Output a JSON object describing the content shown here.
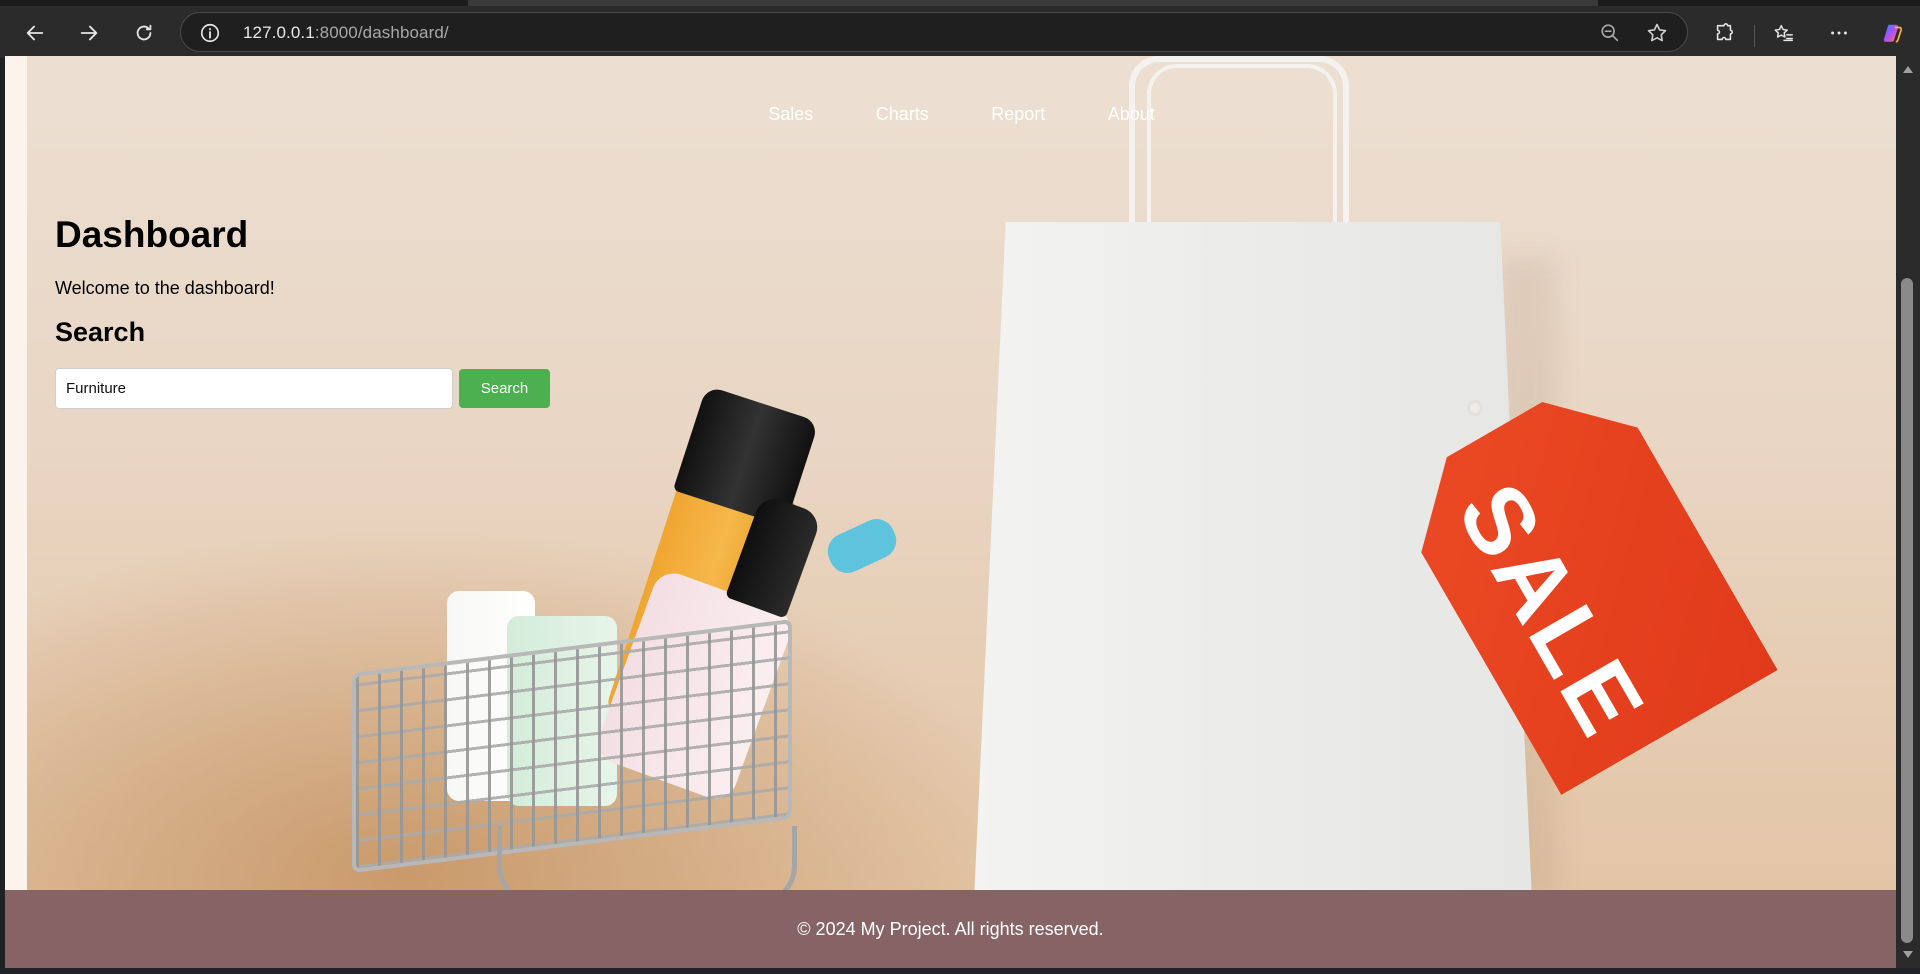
{
  "browser": {
    "url_host": "127.0.0.1",
    "url_rest": ":8000/dashboard/",
    "icons": {
      "back": "arrow-left",
      "forward": "arrow-right",
      "reload": "reload",
      "info": "info-circle",
      "zoom": "zoom-out",
      "favorite": "star",
      "extensions": "puzzle",
      "favorites": "star-list",
      "more": "ellipsis",
      "copilot": "copilot"
    }
  },
  "nav": {
    "items": [
      {
        "label": "Sales"
      },
      {
        "label": "Charts"
      },
      {
        "label": "Report"
      },
      {
        "label": "About"
      }
    ]
  },
  "main": {
    "title": "Dashboard",
    "welcome": "Welcome to the dashboard!",
    "search_heading": "Search",
    "search_value": "Furniture",
    "search_button": "Search",
    "hero_tag_text": "SALE"
  },
  "footer": {
    "text": "© 2024 My Project. All rights reserved."
  },
  "colors": {
    "footer_bg": "#866466",
    "search_button_bg": "#4caf50",
    "tag_red": "#e03a1a"
  }
}
